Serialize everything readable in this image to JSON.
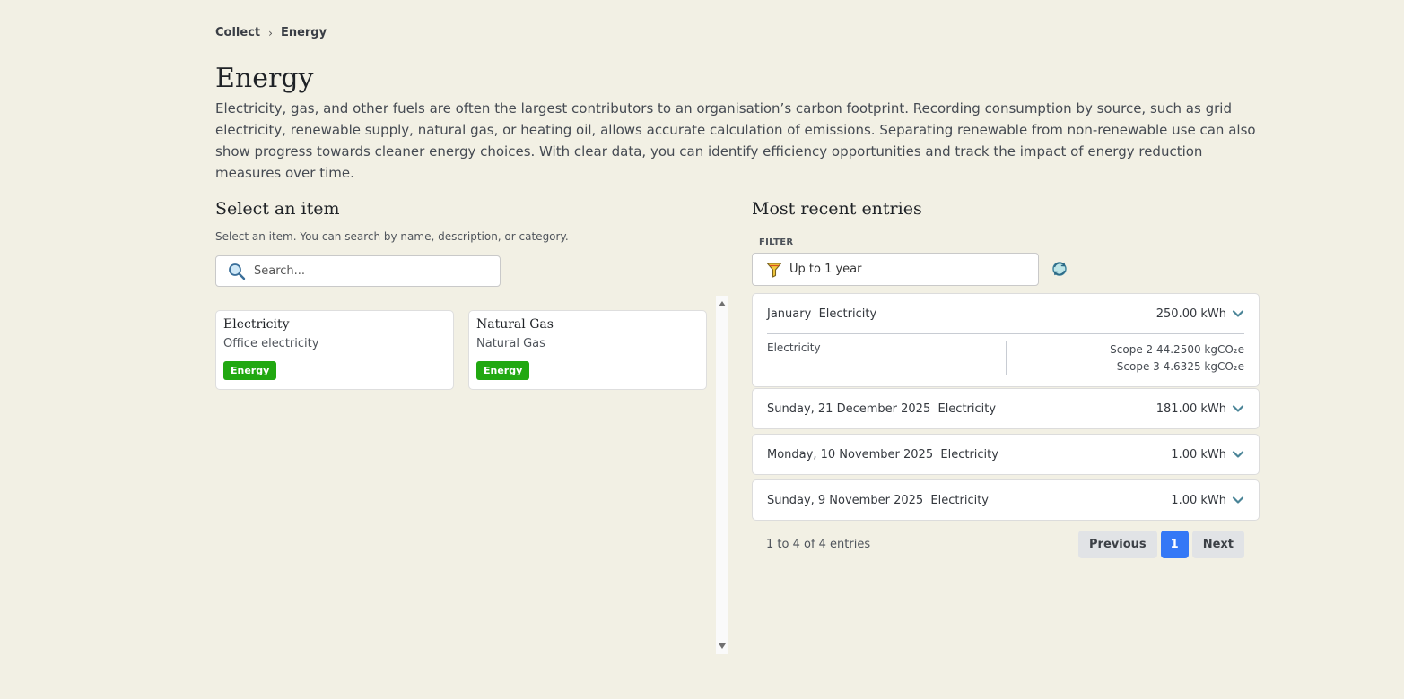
{
  "breadcrumb": {
    "root": "Collect",
    "current": "Energy"
  },
  "page": {
    "title": "Energy",
    "description": "Electricity, gas, and other fuels are often the largest contributors to an organisation’s carbon footprint. Recording consumption by source, such as grid electricity, renewable supply, natural gas, or heating oil, allows accurate calculation of emissions. Separating renewable from non-renewable use can also show progress towards cleaner energy choices. With clear data, you can identify efficiency opportunities and track the impact of energy reduction measures over time."
  },
  "select": {
    "heading": "Select an item",
    "hint": "Select an item. You can search by name, description, or category.",
    "search_placeholder": "Search...",
    "items": [
      {
        "title": "Electricity",
        "subtitle": "Office electricity",
        "badge": "Energy"
      },
      {
        "title": "Natural Gas",
        "subtitle": "Natural Gas",
        "badge": "Energy"
      }
    ]
  },
  "recent": {
    "heading": "Most recent entries",
    "filter_label": "FILTER",
    "filter_value": "Up to 1 year",
    "entries": [
      {
        "date": "January",
        "item": "Electricity",
        "amount": "250.00 kWh",
        "detail_label": "Electricity",
        "scope2": "Scope 2 44.2500 kgCO₂e",
        "scope3": "Scope 3 4.6325 kgCO₂e"
      },
      {
        "date": "Sunday, 21 December 2025",
        "item": "Electricity",
        "amount": "181.00 kWh"
      },
      {
        "date": "Monday, 10 November 2025",
        "item": "Electricity",
        "amount": "1.00 kWh"
      },
      {
        "date": "Sunday, 9 November 2025",
        "item": "Electricity",
        "amount": "1.00 kWh"
      }
    ],
    "pagination": {
      "info": "1 to 4 of 4 entries",
      "previous": "Previous",
      "page": "1",
      "next": "Next"
    }
  },
  "colors": {
    "background": "#f2f0e4",
    "badge": "#21a811",
    "accent": "#3478f6"
  }
}
